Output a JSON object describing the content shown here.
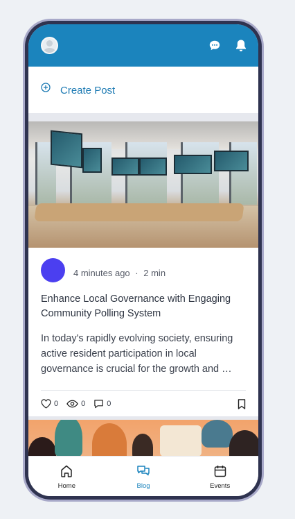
{
  "header": {
    "avatar_icon": "user-avatar-icon",
    "chat_icon": "chat-icon",
    "bell_icon": "bell-icon"
  },
  "create_post": {
    "icon": "plus-circle-icon",
    "label": "Create Post"
  },
  "posts": [
    {
      "time_ago": "4 minutes ago",
      "separator": "·",
      "read_time": "2 min",
      "title": "Enhance Local Governance with Engaging Community Polling System",
      "excerpt": "In today's rapidly evolving society, ensuring active resident participation in local governance is crucial for the growth and …",
      "likes": "0",
      "views": "0",
      "comments": "0",
      "avatar_color": "#4b3ff0"
    }
  ],
  "nav": {
    "items": [
      {
        "label": "Home",
        "icon": "home-icon",
        "active": false
      },
      {
        "label": "Blog",
        "icon": "blog-icon",
        "active": true
      },
      {
        "label": "Events",
        "icon": "calendar-icon",
        "active": false
      }
    ]
  },
  "colors": {
    "brand": "#1b84bd",
    "accent_text": "#1c7ab3"
  }
}
